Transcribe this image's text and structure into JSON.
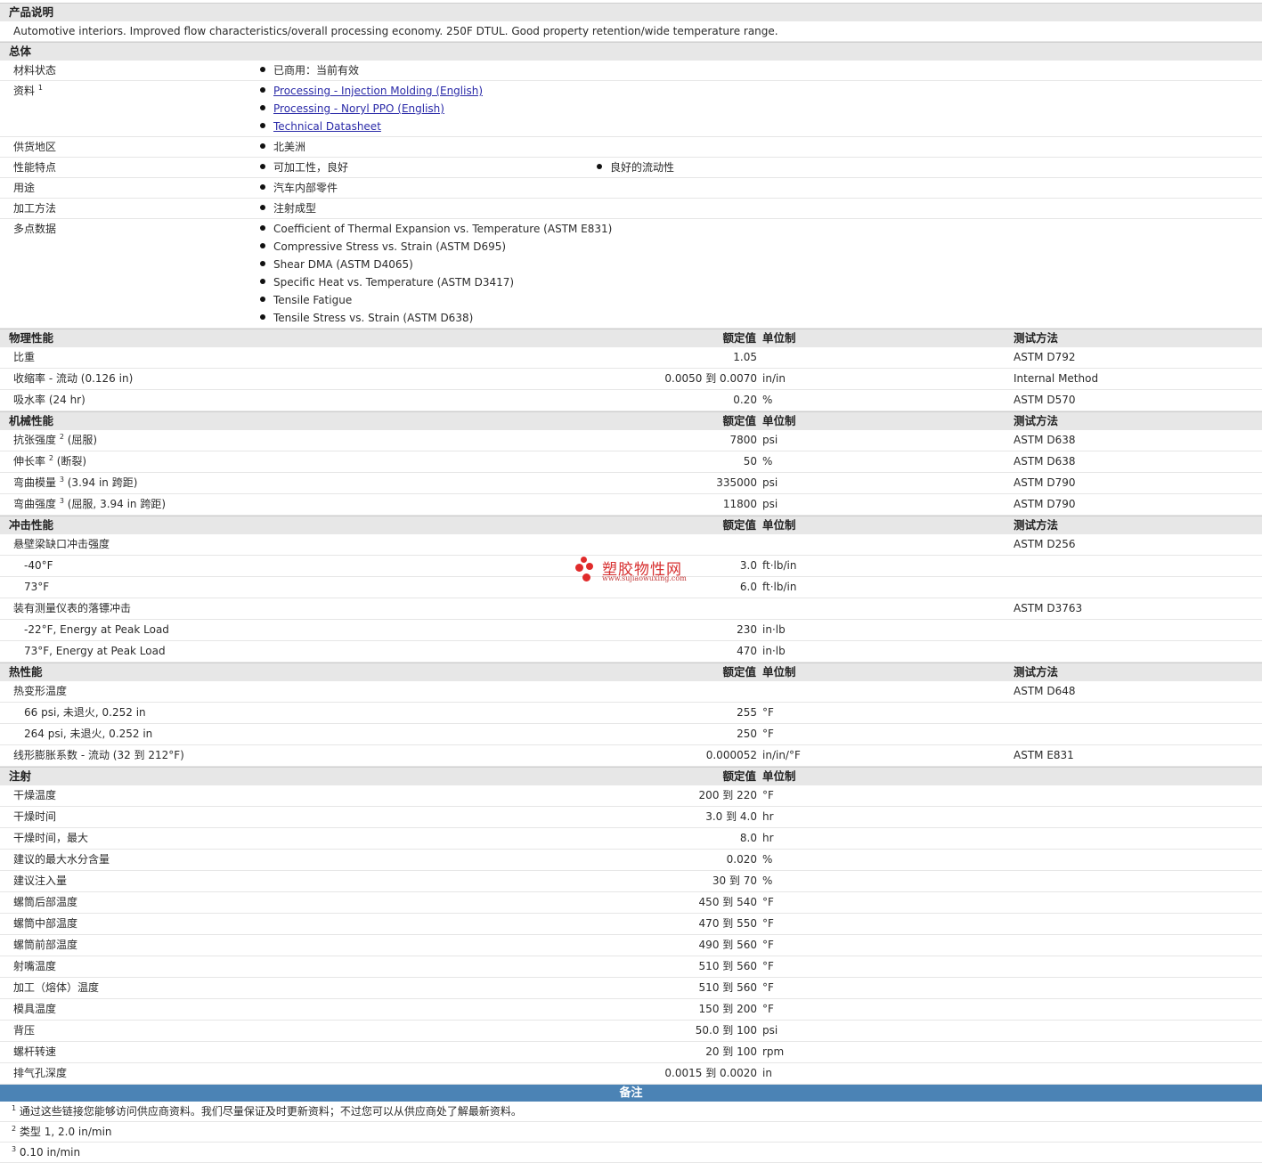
{
  "product": {
    "header": "产品说明",
    "description": "Automotive interiors. Improved flow characteristics/overall processing economy. 250F DTUL. Good property retention/wide temperature range."
  },
  "general": {
    "header": "总体",
    "status_label": "材料状态",
    "status_value": "已商用：当前有效",
    "docs_label": "资料",
    "docs_sup": "1",
    "docs": [
      "Processing - Injection Molding (English)",
      "Processing - Noryl PPO (English)",
      "Technical Datasheet"
    ],
    "region_label": "供货地区",
    "region_value": "北美洲",
    "features_label": "性能特点",
    "features": [
      "可加工性，良好",
      "良好的流动性"
    ],
    "uses_label": "用途",
    "uses_value": "汽车内部零件",
    "process_label": "加工方法",
    "process_value": "注射成型",
    "multipoint_label": "多点数据",
    "multipoint": [
      "Coefficient of Thermal Expansion vs. Temperature (ASTM E831)",
      "Compressive Stress vs. Strain (ASTM D695)",
      "Shear DMA (ASTM D4065)",
      "Specific Heat vs. Temperature (ASTM D3417)",
      "Tensile Fatigue",
      "Tensile Stress vs. Strain (ASTM D638)"
    ]
  },
  "col_headers": {
    "value": "额定值",
    "unit": "单位制",
    "test": "测试方法"
  },
  "physical": {
    "header": "物理性能",
    "rows": [
      {
        "label": "比重",
        "value": "1.05",
        "unit": "",
        "test": "ASTM D792"
      },
      {
        "label": "收缩率 - 流动 (0.126 in)",
        "value": "0.0050 到  0.0070",
        "unit": "in/in",
        "test": "Internal Method"
      },
      {
        "label": "吸水率 (24 hr)",
        "value": "0.20",
        "unit": "%",
        "test": "ASTM D570"
      }
    ]
  },
  "mechanical": {
    "header": "机械性能",
    "rows": [
      {
        "label": "抗张强度",
        "sup": "2",
        "suffix": " (屈服)",
        "value": "7800",
        "unit": "psi",
        "test": "ASTM D638"
      },
      {
        "label": "伸长率",
        "sup": "2",
        "suffix": " (断裂)",
        "value": "50",
        "unit": "%",
        "test": "ASTM D638"
      },
      {
        "label": "弯曲模量",
        "sup": "3",
        "suffix": " (3.94 in 跨距)",
        "value": "335000",
        "unit": "psi",
        "test": "ASTM D790"
      },
      {
        "label": "弯曲强度",
        "sup": "3",
        "suffix": " (屈服, 3.94 in 跨距)",
        "value": "11800",
        "unit": "psi",
        "test": "ASTM D790"
      }
    ]
  },
  "impact": {
    "header": "冲击性能",
    "rows": [
      {
        "label": "悬壁梁缺口冲击强度",
        "value": "",
        "unit": "",
        "test": "ASTM D256"
      },
      {
        "label": "-40°F",
        "indent": true,
        "value": "3.0",
        "unit": "ft·lb/in",
        "test": ""
      },
      {
        "label": "73°F",
        "indent": true,
        "value": "6.0",
        "unit": "ft·lb/in",
        "test": ""
      },
      {
        "label": "装有测量仪表的落镖冲击",
        "value": "",
        "unit": "",
        "test": "ASTM D3763"
      },
      {
        "label": "-22°F, Energy at Peak Load",
        "indent": true,
        "value": "230",
        "unit": "in·lb",
        "test": ""
      },
      {
        "label": "73°F, Energy at Peak Load",
        "indent": true,
        "value": "470",
        "unit": "in·lb",
        "test": ""
      }
    ]
  },
  "thermal": {
    "header": "热性能",
    "rows": [
      {
        "label": "热变形温度",
        "value": "",
        "unit": "",
        "test": "ASTM D648"
      },
      {
        "label": "66 psi, 未退火, 0.252 in",
        "indent": true,
        "value": "255",
        "unit": "°F",
        "test": ""
      },
      {
        "label": "264 psi, 未退火, 0.252 in",
        "indent": true,
        "value": "250",
        "unit": "°F",
        "test": ""
      },
      {
        "label": "线形膨胀系数 - 流动 (32 到  212°F)",
        "value": "0.000052",
        "unit": "in/in/°F",
        "test": "ASTM E831"
      }
    ]
  },
  "injection": {
    "header": "注射",
    "rows": [
      {
        "label": "干燥温度",
        "value": "200 到  220",
        "unit": "°F"
      },
      {
        "label": "干燥时间",
        "value": "3.0 到  4.0",
        "unit": "hr"
      },
      {
        "label": "干燥时间，最大",
        "value": "8.0",
        "unit": "hr"
      },
      {
        "label": "建议的最大水分含量",
        "value": "0.020",
        "unit": "%"
      },
      {
        "label": "建议注入量",
        "value": "30 到  70",
        "unit": "%"
      },
      {
        "label": "螺筒后部温度",
        "value": "450 到  540",
        "unit": "°F"
      },
      {
        "label": "螺筒中部温度",
        "value": "470 到  550",
        "unit": "°F"
      },
      {
        "label": "螺筒前部温度",
        "value": "490 到  560",
        "unit": "°F"
      },
      {
        "label": "射嘴温度",
        "value": "510 到  560",
        "unit": "°F"
      },
      {
        "label": "加工（熔体）温度",
        "value": "510 到  560",
        "unit": "°F"
      },
      {
        "label": "模具温度",
        "value": "150 到  200",
        "unit": "°F"
      },
      {
        "label": "背压",
        "value": "50.0 到  100",
        "unit": "psi"
      },
      {
        "label": "螺杆转速",
        "value": "20 到  100",
        "unit": "rpm"
      },
      {
        "label": "排气孔深度",
        "value": "0.0015 到  0.0020",
        "unit": "in"
      }
    ]
  },
  "notes": {
    "header": "备注",
    "items": [
      {
        "sup": "1",
        "text": "通过这些链接您能够访问供应商资料。我们尽量保证及时更新资料；不过您可以从供应商处了解最新资料。"
      },
      {
        "sup": "2",
        "text": "类型  1, 2.0 in/min"
      },
      {
        "sup": "3",
        "text": "0.10 in/min"
      }
    ]
  },
  "watermark": {
    "title": "塑胶物性网",
    "url": "www.sujiaowuxing.com"
  }
}
